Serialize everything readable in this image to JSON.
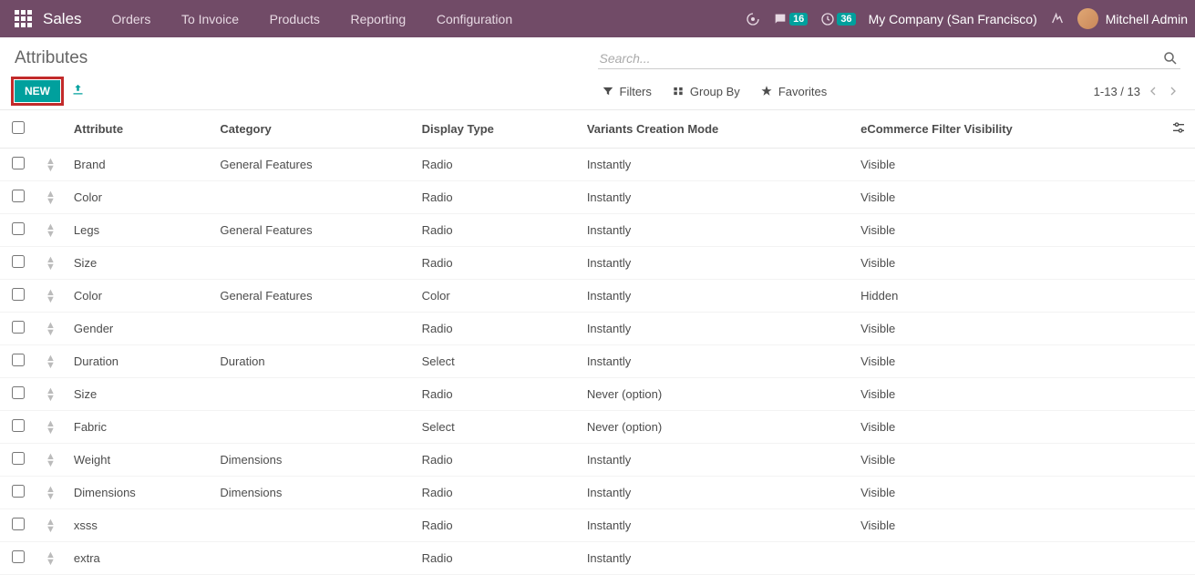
{
  "topbar": {
    "brand": "Sales",
    "menu": [
      "Orders",
      "To Invoice",
      "Products",
      "Reporting",
      "Configuration"
    ],
    "msg_badge": "16",
    "timer_badge": "36",
    "company": "My Company (San Francisco)",
    "user": "Mitchell Admin"
  },
  "header": {
    "title": "Attributes",
    "search_placeholder": "Search...",
    "new_label": "NEW",
    "filters_label": "Filters",
    "groupby_label": "Group By",
    "favorites_label": "Favorites",
    "pager": "1-13 / 13"
  },
  "columns": {
    "attribute": "Attribute",
    "category": "Category",
    "display_type": "Display Type",
    "variants": "Variants Creation Mode",
    "ecom": "eCommerce Filter Visibility"
  },
  "rows": [
    {
      "attribute": "Brand",
      "category": "General Features",
      "display": "Radio",
      "variants": "Instantly",
      "ecom": "Visible"
    },
    {
      "attribute": "Color",
      "category": "",
      "display": "Radio",
      "variants": "Instantly",
      "ecom": "Visible"
    },
    {
      "attribute": "Legs",
      "category": "General Features",
      "display": "Radio",
      "variants": "Instantly",
      "ecom": "Visible"
    },
    {
      "attribute": "Size",
      "category": "",
      "display": "Radio",
      "variants": "Instantly",
      "ecom": "Visible"
    },
    {
      "attribute": "Color",
      "category": "General Features",
      "display": "Color",
      "variants": "Instantly",
      "ecom": "Hidden"
    },
    {
      "attribute": "Gender",
      "category": "",
      "display": "Radio",
      "variants": "Instantly",
      "ecom": "Visible"
    },
    {
      "attribute": "Duration",
      "category": "Duration",
      "display": "Select",
      "variants": "Instantly",
      "ecom": "Visible"
    },
    {
      "attribute": "Size",
      "category": "",
      "display": "Radio",
      "variants": "Never (option)",
      "ecom": "Visible"
    },
    {
      "attribute": "Fabric",
      "category": "",
      "display": "Select",
      "variants": "Never (option)",
      "ecom": "Visible"
    },
    {
      "attribute": "Weight",
      "category": "Dimensions",
      "display": "Radio",
      "variants": "Instantly",
      "ecom": "Visible"
    },
    {
      "attribute": "Dimensions",
      "category": "Dimensions",
      "display": "Radio",
      "variants": "Instantly",
      "ecom": "Visible"
    },
    {
      "attribute": "xsss",
      "category": "",
      "display": "Radio",
      "variants": "Instantly",
      "ecom": "Visible"
    },
    {
      "attribute": "extra",
      "category": "",
      "display": "Radio",
      "variants": "Instantly",
      "ecom": ""
    }
  ]
}
